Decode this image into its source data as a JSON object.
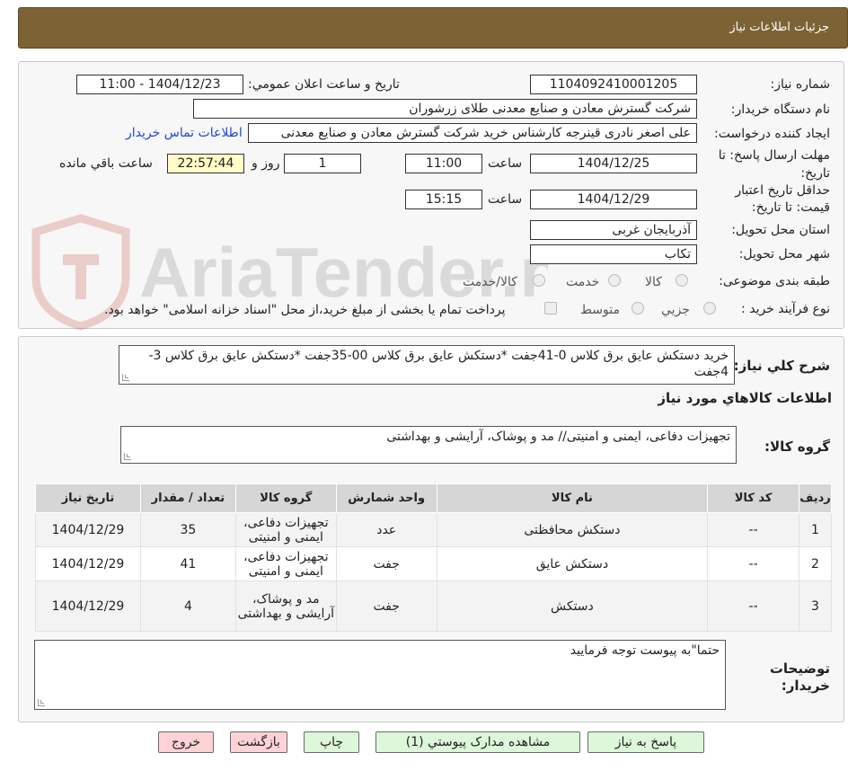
{
  "header": {
    "title": "جزئیات اطلاعات نیاز"
  },
  "form": {
    "need_number_label": "شماره نیاز:",
    "need_number": "1104092410001205",
    "announce_label": "تاریخ و ساعت اعلان عمومي:",
    "announce_value": "1404/12/23 - 11:00",
    "buyer_org_label": "نام دستگاه خريدار:",
    "buyer_org": "شرکت گسترش معادن و صنایع معدنی طلای زرشوران",
    "creator_label": "ايجاد کننده درخواست:",
    "creator": "علی اصغر نادری قینرجه کارشناس خرید  شرکت گسترش معادن و صنایع معدنی",
    "contact_link": "اطلاعات تماس خريدار",
    "deadline_label_1": "مهلت ارسال پاسخ: تا",
    "deadline_label_2": "تاريخ:",
    "deadline_date": "1404/12/25",
    "time_label": "ساعت",
    "deadline_time": "11:00",
    "days_value": "1",
    "days_label": "روز و",
    "remaining_time": "22:57:44",
    "remaining_label": "ساعت باقي مانده",
    "validity_label_1": "حداقل تاريخ اعتبار",
    "validity_label_2": "قيمت: تا تاريخ:",
    "validity_date": "1404/12/29",
    "validity_time": "15:15",
    "province_label": "استان محل تحويل:",
    "province": "آذربایجان غربی",
    "city_label": "شهر محل تحويل:",
    "city": "تکاب",
    "category_label": "طبقه بندی موضوعی:",
    "category_options": [
      "کالا",
      "خدمت",
      "کالا/خدمت"
    ],
    "process_label": "نوع فرآيند خريد :",
    "process_options": [
      "جزيي",
      "متوسط"
    ],
    "payment_note": "پرداخت تمام يا بخشی از مبلغ خريد،از محل \"اسناد خزانه اسلامی\" خواهد بود."
  },
  "watermark": {
    "text": "AriaTender.neT"
  },
  "details": {
    "summary_label": "شرح کلي نياز:",
    "summary": "خرید دستکش عایق برق کلاس 0-41جفت *دستکش عایق برق کلاس 00-35جفت *دستکش عایق برق کلاس 3-4جفت",
    "goods_section_title": "اطلاعات کالاهاي مورد نياز",
    "goods_group_label": "گروه کالا:",
    "goods_group": "تجهیزات دفاعی، ایمنی و امنیتی// مد و پوشاک، آرایشی و بهداشتی",
    "table": {
      "headers": [
        "رديف",
        "کد کالا",
        "نام کالا",
        "واحد شمارش",
        "گروه کالا",
        "تعداد / مقدار",
        "تاريخ نياز"
      ],
      "rows": [
        [
          "1",
          "--",
          "دستکش محافظتی",
          "عدد",
          "تجهیزات دفاعی، ایمنی و امنیتی",
          "35",
          "1404/12/29"
        ],
        [
          "2",
          "--",
          "دستکش عایق",
          "جفت",
          "تجهیزات دفاعی، ایمنی و امنیتی",
          "41",
          "1404/12/29"
        ],
        [
          "3",
          "--",
          "دستکش",
          "جفت",
          "مد و پوشاک، آرایشی و بهداشتی",
          "4",
          "1404/12/29"
        ]
      ]
    },
    "buyer_notes_label_1": "توضيحات",
    "buyer_notes_label_2": "خريدار:",
    "buyer_notes": "حتما\"به پیوست توجه فرمایید"
  },
  "buttons": {
    "reply": "پاسخ به نياز",
    "attachments": "مشاهده مدارک پيوستي (1)",
    "print": "چاپ",
    "back": "بازگشت",
    "exit": "خروج"
  }
}
